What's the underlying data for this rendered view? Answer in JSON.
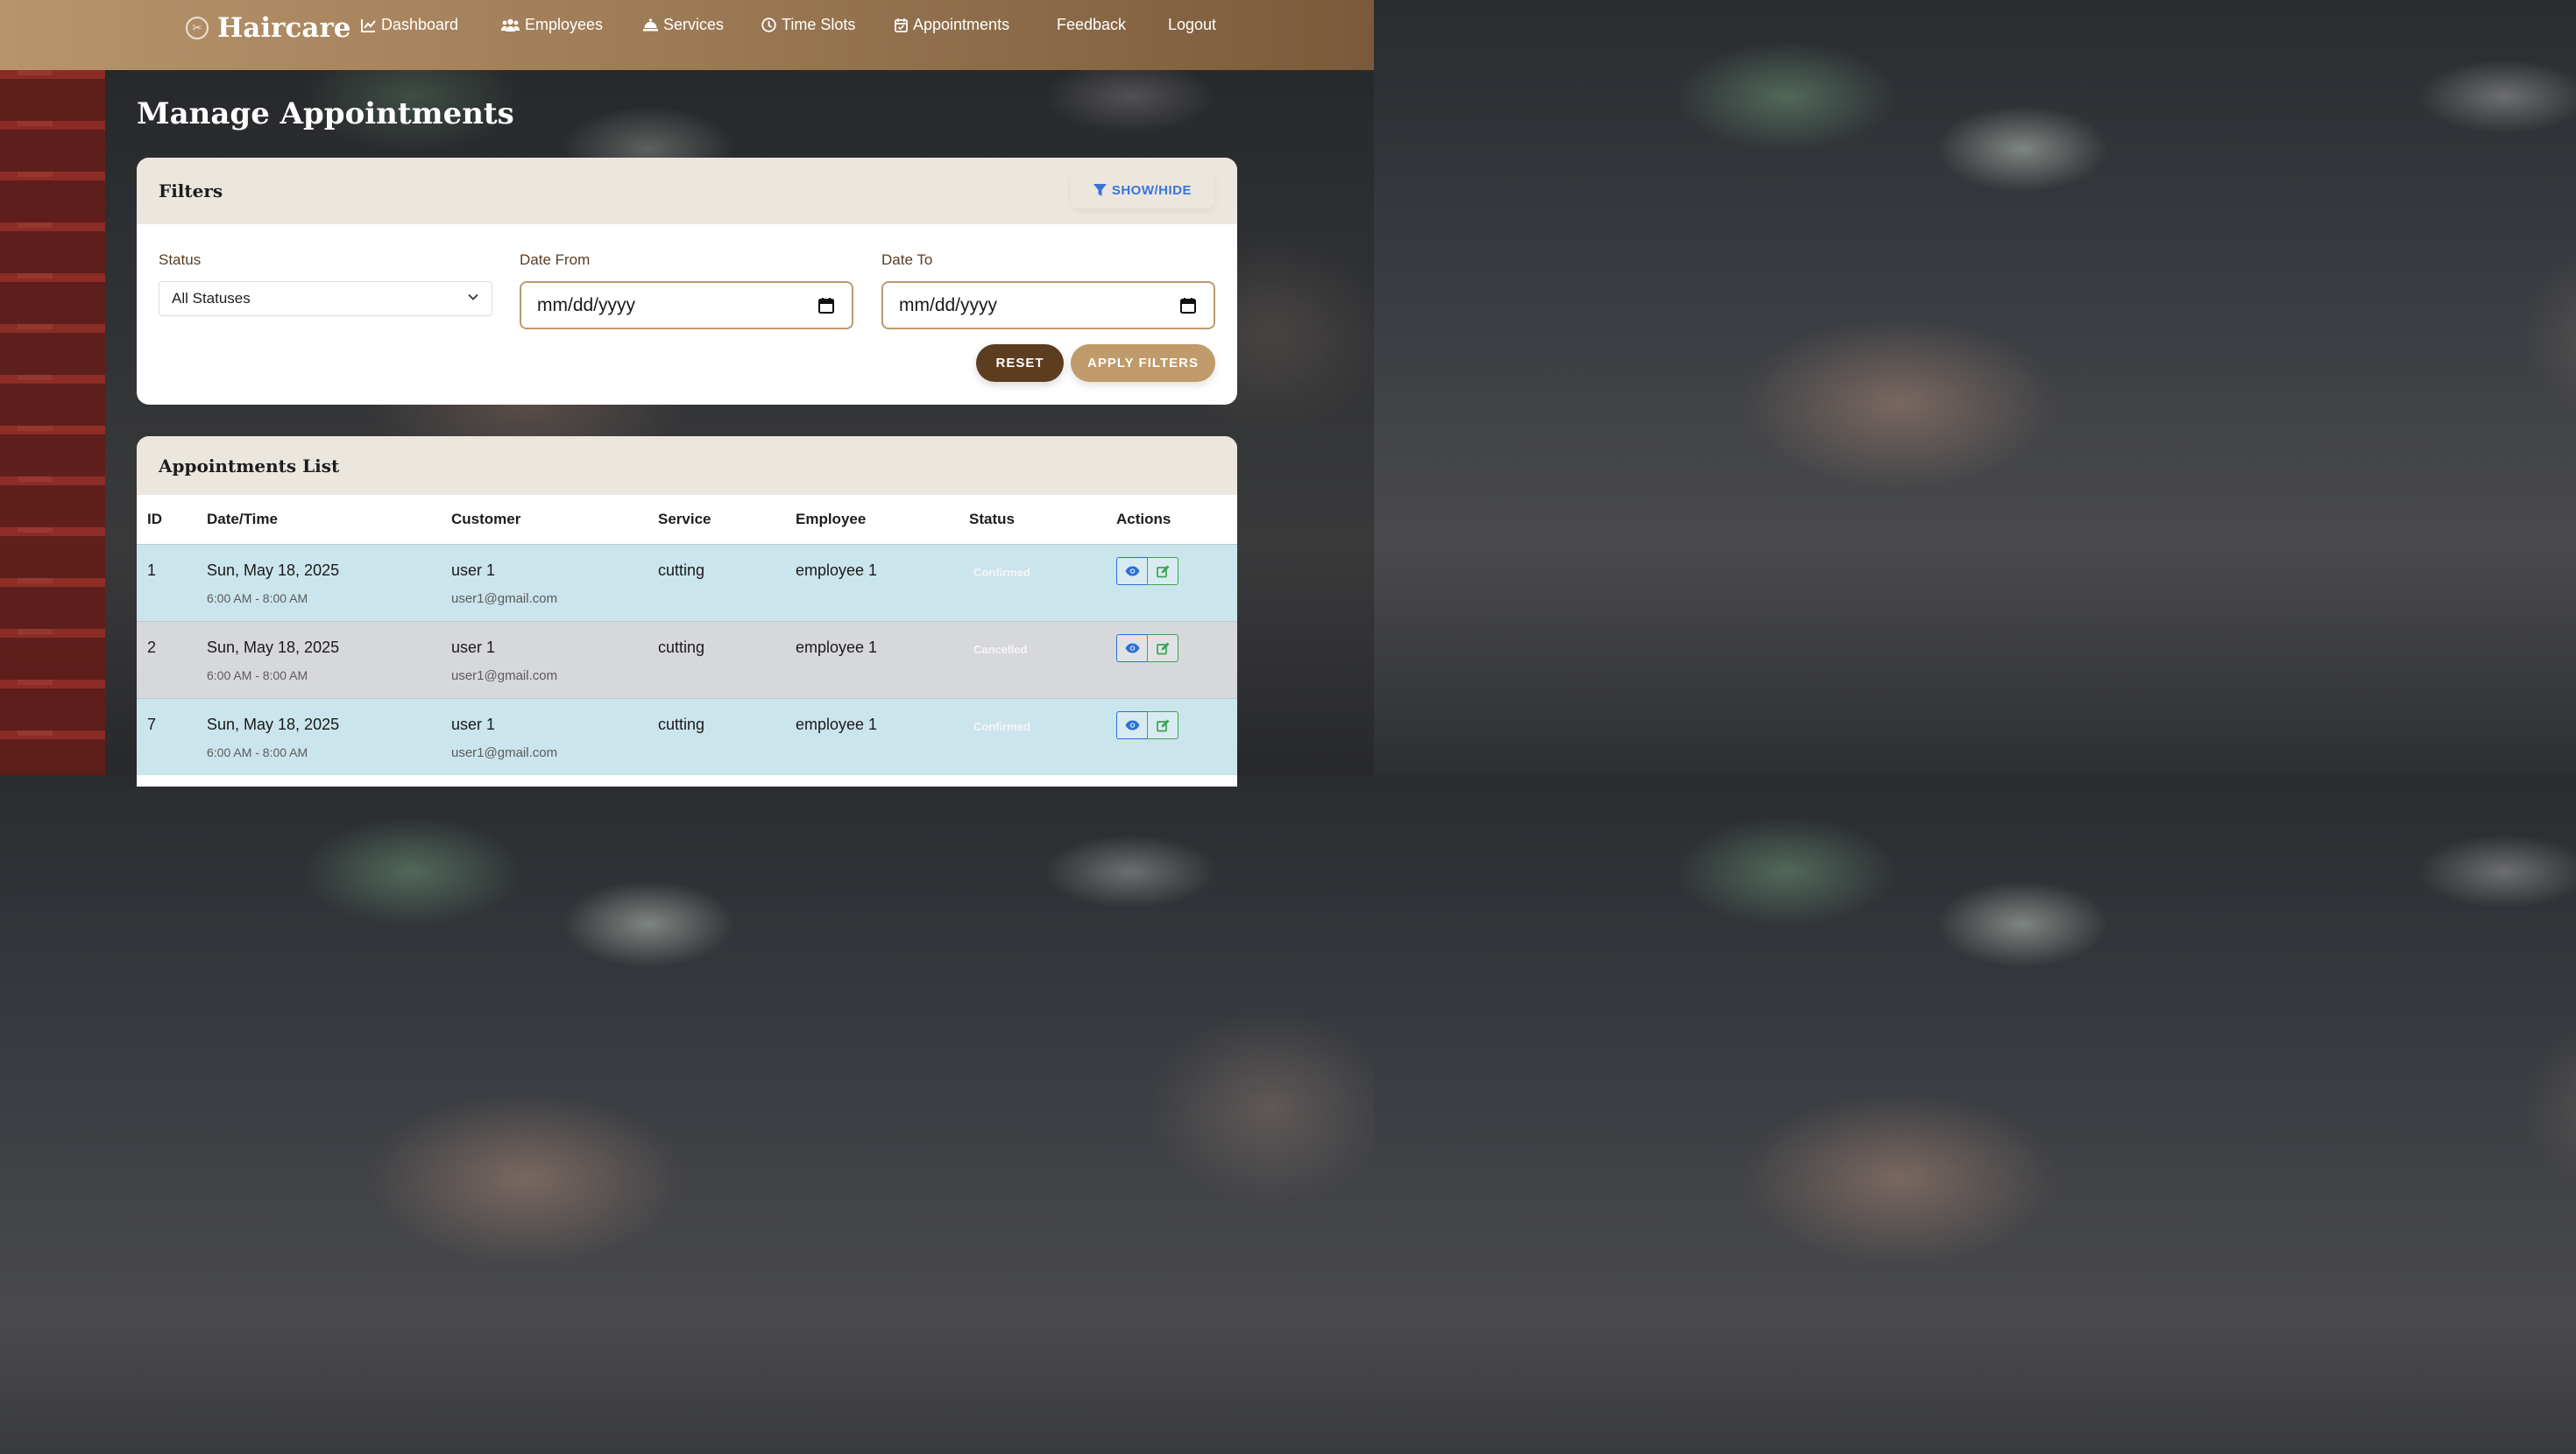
{
  "nav": {
    "brand": "Haircare",
    "items": [
      {
        "label": "Dashboard",
        "icon": "chart-line-icon"
      },
      {
        "label": "Employees",
        "icon": "users-icon"
      },
      {
        "label": "Services",
        "icon": "service-bell-icon"
      },
      {
        "label": "Time Slots",
        "icon": "clock-icon"
      },
      {
        "label": "Appointments",
        "icon": "calendar-check-icon"
      },
      {
        "label": "Feedback",
        "icon": ""
      },
      {
        "label": "Logout",
        "icon": ""
      }
    ]
  },
  "page_title": "Manage Appointments",
  "filters": {
    "title": "Filters",
    "toggle_label": "SHOW/HIDE",
    "status_label": "Status",
    "status_value": "All Statuses",
    "date_from_label": "Date From",
    "date_from_value": "mm/dd/yyyy",
    "date_to_label": "Date To",
    "date_to_value": "mm/dd/yyyy",
    "reset_label": "RESET",
    "apply_label": "APPLY FILTERS"
  },
  "list": {
    "title": "Appointments List",
    "columns": [
      "ID",
      "Date/Time",
      "Customer",
      "Service",
      "Employee",
      "Status",
      "Actions"
    ],
    "rows": [
      {
        "id": "1",
        "date": "Sun, May 18, 2025",
        "time": "6:00 AM - 8:00 AM",
        "customer": "user 1",
        "email": "user1@gmail.com",
        "service": "cutting",
        "employee": "employee 1",
        "status": "Confirmed"
      },
      {
        "id": "2",
        "date": "Sun, May 18, 2025",
        "time": "6:00 AM - 8:00 AM",
        "customer": "user 1",
        "email": "user1@gmail.com",
        "service": "cutting",
        "employee": "employee 1",
        "status": "Cancelled"
      },
      {
        "id": "7",
        "date": "Sun, May 18, 2025",
        "time": "6:00 AM - 8:00 AM",
        "customer": "user 1",
        "email": "user1@gmail.com",
        "service": "cutting",
        "employee": "employee 1",
        "status": "Confirmed"
      }
    ]
  },
  "colors": {
    "nav_start": "#b8946c",
    "nav_end": "#7a5a3a",
    "reset_button": "#5c3d20",
    "apply_button": "#bf9a6a",
    "confirmed_row": "#cbe5ec",
    "cancelled_row": "#d7d8dc",
    "view_action": "#2c6fd8",
    "edit_action": "#3ea24f"
  }
}
